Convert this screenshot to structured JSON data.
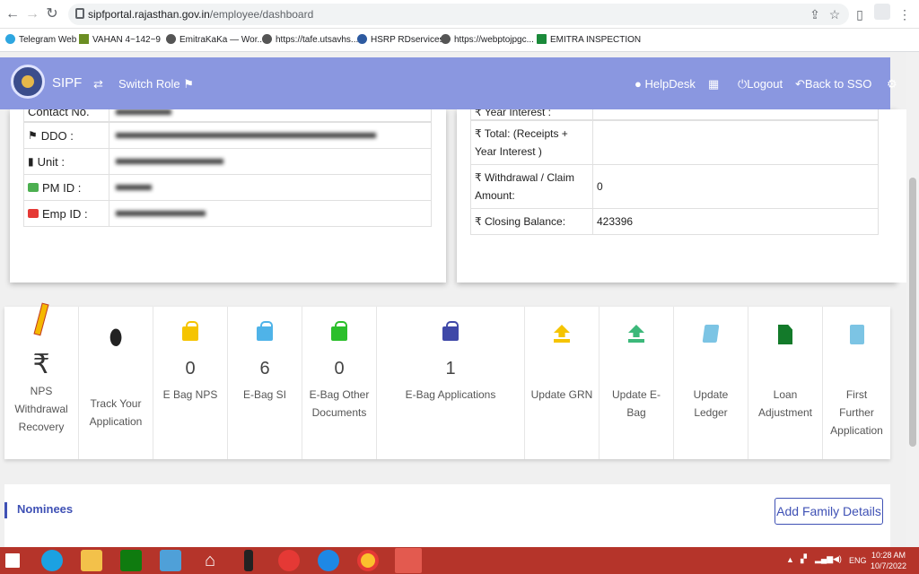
{
  "browser": {
    "url_host": "sipfportal.rajasthan.gov.in",
    "url_path": "/employee/dashboard",
    "bookmarks": [
      "Telegram Web",
      "VAHAN 4~142~9",
      "EmitraKaKa — Wor...",
      "https://tafe.utsavhs...",
      "HSRP RDservices",
      "https://webptojpgc...",
      "EMITRA INSPECTION"
    ]
  },
  "navbar": {
    "brand": "SIPF",
    "switch_role": "Switch Role",
    "helpdesk": "HelpDesk",
    "logout": "Logout",
    "back_to_sso": "Back to SSO"
  },
  "profile": {
    "contact_label": "Contact No.",
    "rows": [
      {
        "label": "DDO :",
        "value": ""
      },
      {
        "label": "Unit :",
        "value": ""
      },
      {
        "label": "PM ID :",
        "value": ""
      },
      {
        "label": "Emp ID :",
        "value": ""
      }
    ]
  },
  "summary": {
    "year_interest_label": "₹ Year Interest :",
    "rows": [
      {
        "label": "₹ Total: (Receipts + Year Interest )",
        "value": ""
      },
      {
        "label": "₹ Withdrawal / Claim Amount:",
        "value": "0"
      },
      {
        "label": "₹ Closing Balance:",
        "value": "423396"
      }
    ]
  },
  "tiles": [
    {
      "caption": "NPS Withdrawal Recovery",
      "count": ""
    },
    {
      "caption": "Track Your Application",
      "count": ""
    },
    {
      "caption": "E Bag NPS",
      "count": "0"
    },
    {
      "caption": "E-Bag SI",
      "count": "6"
    },
    {
      "caption": "E-Bag Other Documents",
      "count": "0"
    },
    {
      "caption": "E-Bag Applications",
      "count": "1"
    },
    {
      "caption": "Update GRN",
      "count": ""
    },
    {
      "caption": "Update E-Bag",
      "count": ""
    },
    {
      "caption": "Update Ledger",
      "count": ""
    },
    {
      "caption": "Loan Adjustment",
      "count": ""
    },
    {
      "caption": "First Further Application",
      "count": ""
    }
  ],
  "nominees": {
    "title": "Nominees",
    "add_family": "Add Family Details"
  },
  "taskbar": {
    "language": "ENG",
    "time": "10:28 AM",
    "date": "10/7/2022"
  }
}
